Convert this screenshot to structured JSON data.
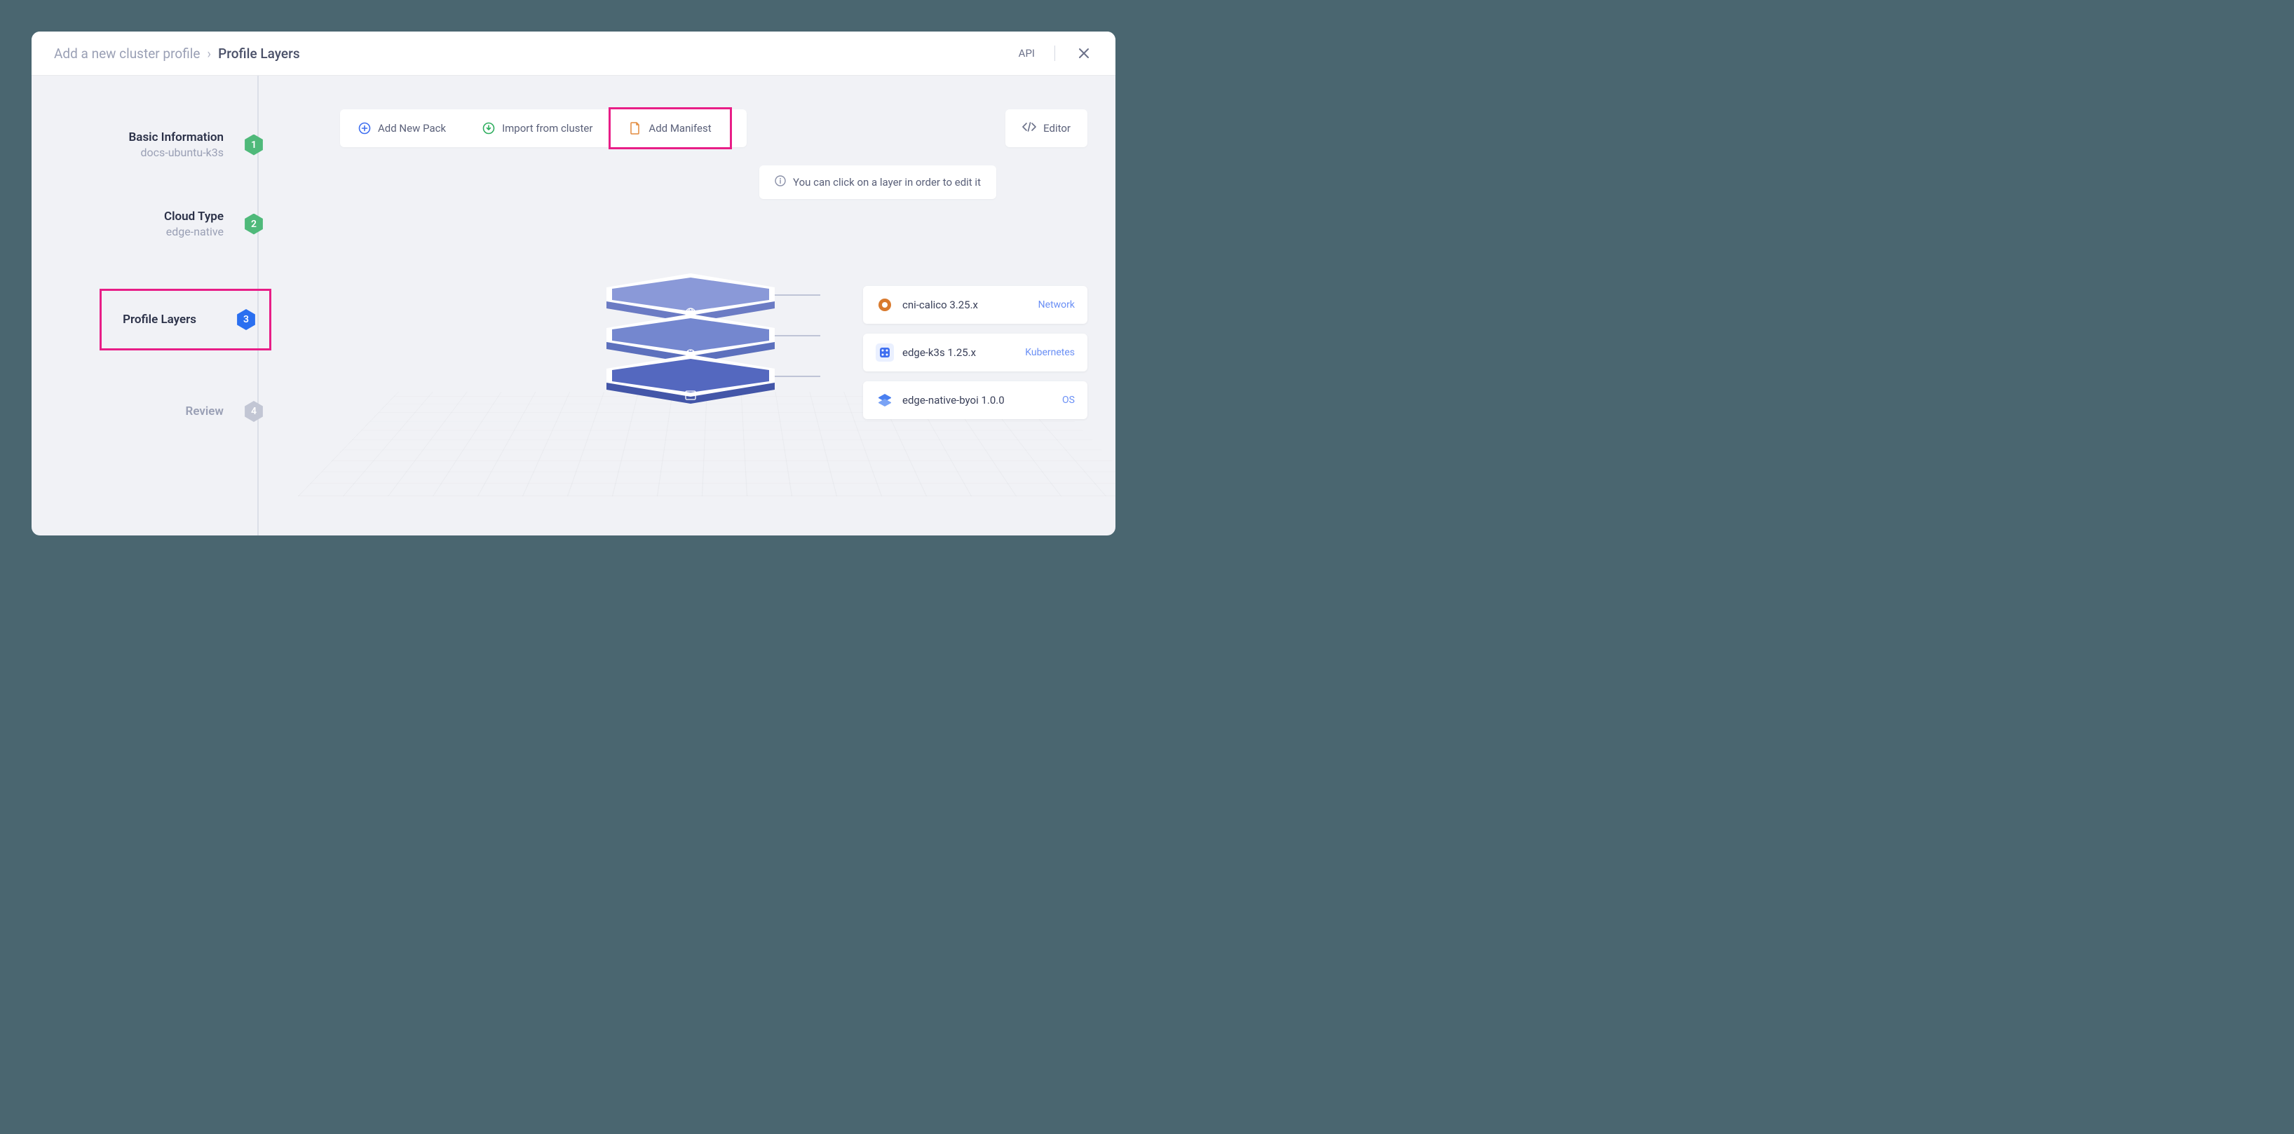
{
  "header": {
    "breadcrumb_root": "Add a new cluster profile",
    "breadcrumb_current": "Profile Layers",
    "api_label": "API"
  },
  "steps": [
    {
      "title": "Basic Information",
      "sub": "docs-ubuntu-k3s",
      "num": "1",
      "state": "green"
    },
    {
      "title": "Cloud Type",
      "sub": "edge-native",
      "num": "2",
      "state": "green"
    },
    {
      "title": "Profile Layers",
      "sub": "",
      "num": "3",
      "state": "blue"
    },
    {
      "title": "Review",
      "sub": "",
      "num": "4",
      "state": "gray"
    }
  ],
  "actions": {
    "add_pack": "Add New Pack",
    "import": "Import from cluster",
    "add_manifest": "Add Manifest",
    "editor": "Editor"
  },
  "tip": "You can click on a layer in order to edit it",
  "layers": [
    {
      "name": "cni-calico 3.25.x",
      "type": "Network",
      "icon_color": "#d97a2e"
    },
    {
      "name": "edge-k3s 1.25.x",
      "type": "Kubernetes",
      "icon_color": "#3f6ff0"
    },
    {
      "name": "edge-native-byoi 1.0.0",
      "type": "OS",
      "icon_color": "#3f6ff0"
    }
  ]
}
